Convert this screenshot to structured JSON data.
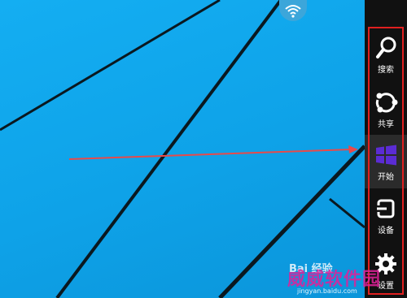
{
  "charms": [
    {
      "name": "search",
      "label": "搜索",
      "icon": "search-icon"
    },
    {
      "name": "share",
      "label": "共享",
      "icon": "share-icon"
    },
    {
      "name": "start",
      "label": "开始",
      "icon": "windows-logo-icon"
    },
    {
      "name": "devices",
      "label": "设备",
      "icon": "devices-icon"
    },
    {
      "name": "settings",
      "label": "设置",
      "icon": "gear-icon"
    }
  ],
  "watermark": {
    "main": "威威软件园",
    "url": "jingyan.baidu.com",
    "brand": "Bai 经验"
  },
  "colors": {
    "desktop": "#0fa0e6",
    "charm_bar": "#111111",
    "highlight_box": "#e02020",
    "start_icon": "#5b2cd4"
  }
}
